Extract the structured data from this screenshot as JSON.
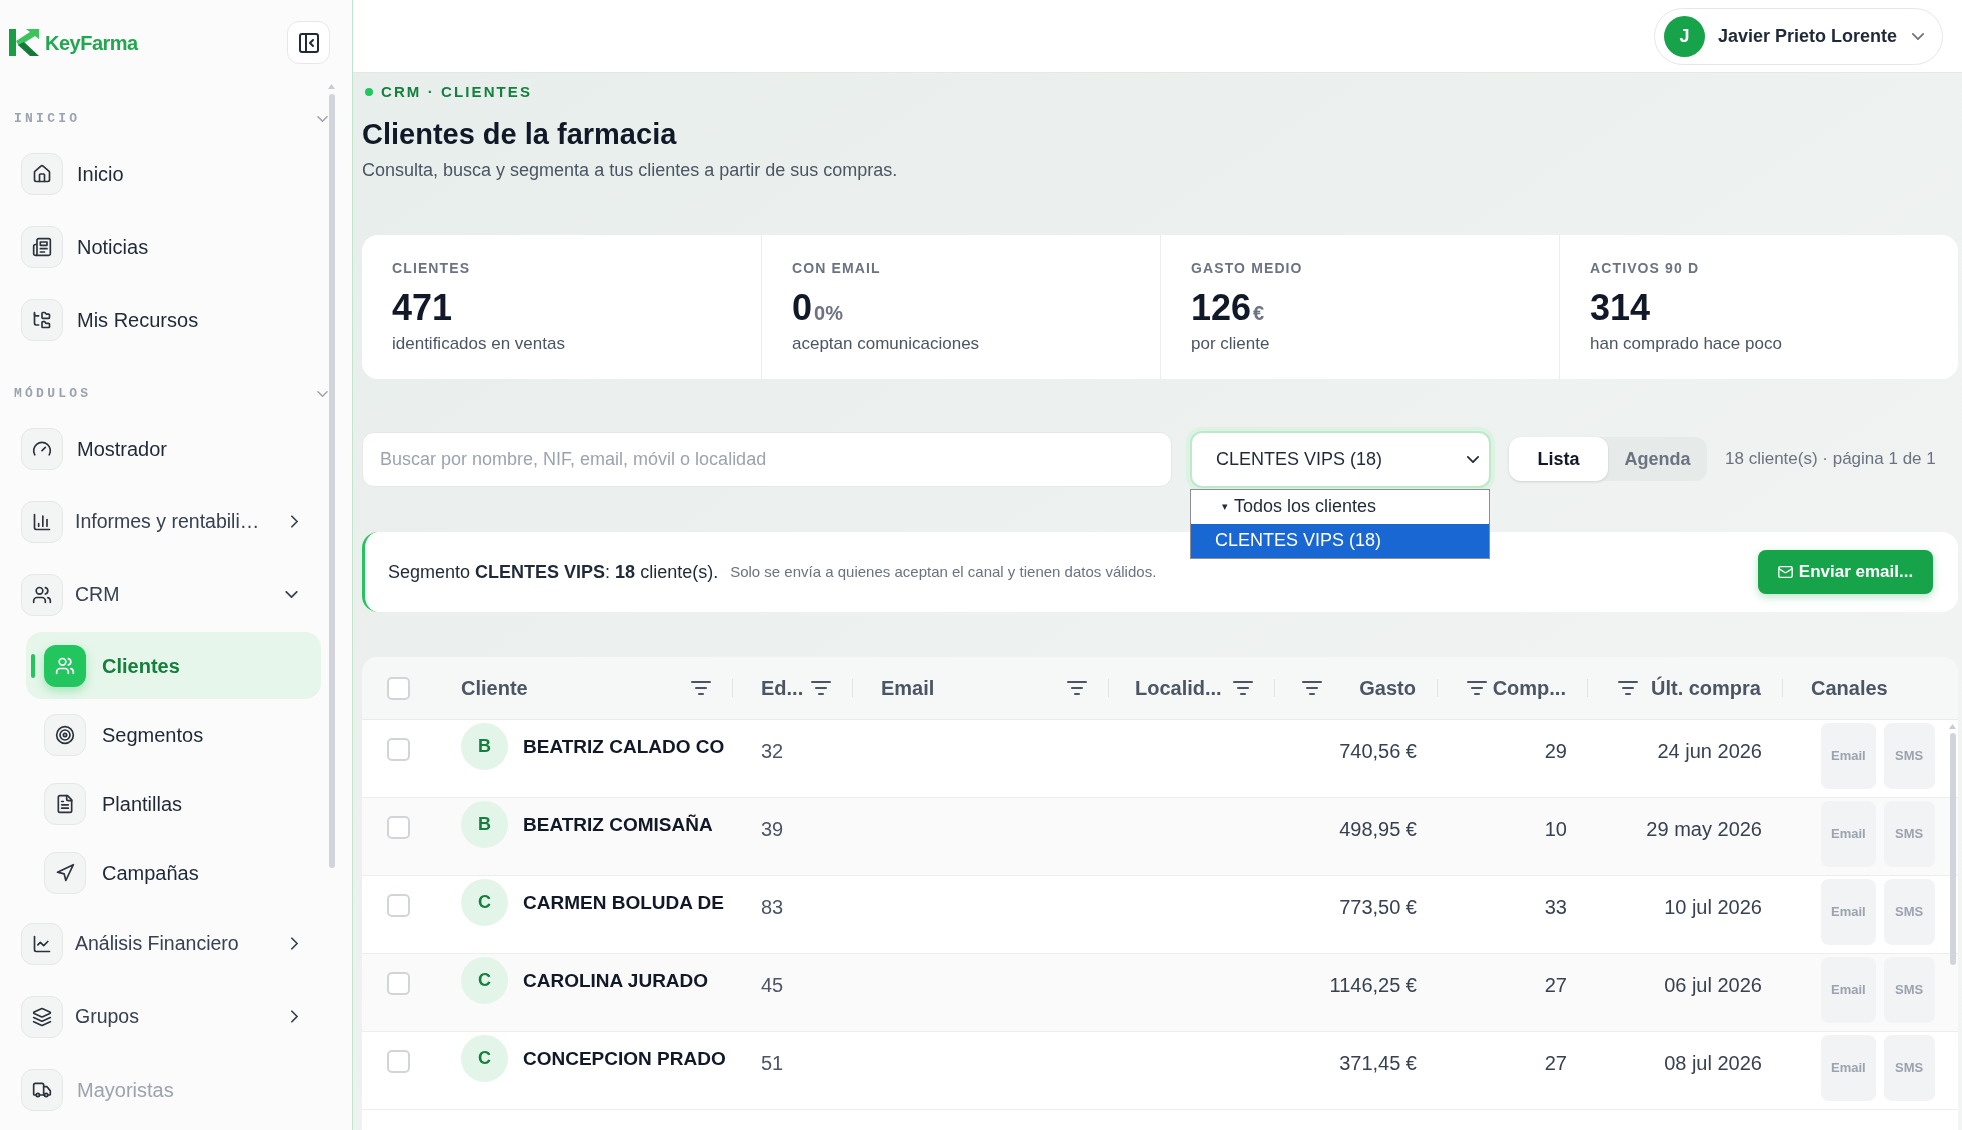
{
  "sidebar": {
    "brand": "KeyFarma",
    "sections": [
      {
        "title": "INICIO",
        "expanded": true,
        "items": [
          {
            "kind": "link",
            "label": "Inicio",
            "selected": false,
            "disabled": false
          },
          {
            "kind": "link",
            "label": "Noticias",
            "selected": false,
            "disabled": false
          },
          {
            "kind": "link",
            "label": "Mis Recursos",
            "selected": false,
            "disabled": false
          }
        ]
      },
      {
        "title": "MÓDULOS",
        "expanded": true,
        "items": [
          {
            "kind": "link",
            "label": "Mostrador",
            "selected": false,
            "disabled": false
          },
          {
            "kind": "group",
            "label": "Informes y rentabili…",
            "expanded": false
          },
          {
            "kind": "group",
            "label": "CRM",
            "expanded": true,
            "children": [
              {
                "label": "Clientes",
                "selected": true
              },
              {
                "label": "Segmentos",
                "selected": false
              },
              {
                "label": "Plantillas",
                "selected": false
              },
              {
                "label": "Campañas",
                "selected": false
              }
            ]
          },
          {
            "kind": "group",
            "label": "Análisis Financiero",
            "expanded": false
          },
          {
            "kind": "group",
            "label": "Grupos",
            "expanded": false
          },
          {
            "kind": "link",
            "label": "Mayoristas",
            "selected": false,
            "disabled": true
          }
        ]
      }
    ]
  },
  "header": {
    "user": {
      "initial": "J",
      "name": "Javier Prieto Lorente"
    }
  },
  "page": {
    "breadcrumb": "CRM · CLIENTES",
    "title": "Clientes de la farmacia",
    "subtitle": "Consulta, busca y segmenta a tus clientes a partir de sus compras."
  },
  "stats": [
    {
      "label": "CLIENTES",
      "value": "471",
      "note": "identificados en ventas"
    },
    {
      "label": "CON EMAIL",
      "value": "0",
      "unit": "0%",
      "note": "aceptan comunicaciones"
    },
    {
      "label": "GASTO MEDIO",
      "value": "126",
      "unit": "€",
      "note": "por cliente"
    },
    {
      "label": "ACTIVOS 90 D",
      "value": "314",
      "note": "han comprado hace poco"
    }
  ],
  "toolbar": {
    "search": {
      "placeholder": "Buscar por nombre, NIF, email, móvil o localidad"
    },
    "segment_select": {
      "value": "CLENTES VIPS (18)",
      "expanded": true,
      "options": [
        {
          "marker": "▾",
          "label": "Todos los clientes",
          "selected": false
        },
        {
          "label": "CLENTES VIPS (18)",
          "selected": true
        }
      ]
    },
    "view_tabs": [
      {
        "label": "Lista",
        "selected": true
      },
      {
        "label": "Agenda",
        "selected": false
      }
    ],
    "results": "18 cliente(s) · página 1 de 1"
  },
  "segment_banner": {
    "summary": "Segmento **CLENTES VIPS**: **18** cliente(s).",
    "note": "Solo se envía a quienes aceptan el canal y tienen datos válidos.",
    "button": "Enviar email..."
  },
  "table": {
    "select_all": {
      "checked": false
    },
    "columns": [
      {
        "label": "Cliente",
        "kind": "text",
        "filter": true
      },
      {
        "label": "Ed...",
        "kind": "text",
        "filter": true
      },
      {
        "label": "Email",
        "kind": "text",
        "filter": true
      },
      {
        "label": "Localid...",
        "kind": "text",
        "filter": true
      },
      {
        "label": "Gasto",
        "kind": "number",
        "filter": true
      },
      {
        "label": "Comp...",
        "kind": "number",
        "filter": true
      },
      {
        "label": "Últ. compra",
        "kind": "number",
        "filter": true
      },
      {
        "label": "Canales",
        "kind": "text",
        "filter": false
      }
    ],
    "rows": [
      {
        "checked": false,
        "initial": "B",
        "name": "BEATRIZ CALADO CO",
        "age": "32",
        "spend": "740,56 €",
        "purchases": "29",
        "last_purchase": "24 jun 2026",
        "channels": [
          {
            "label": "Email",
            "on": false
          },
          {
            "label": "SMS",
            "on": false
          }
        ]
      },
      {
        "checked": false,
        "initial": "B",
        "name": "BEATRIZ COMISAÑA",
        "age": "39",
        "spend": "498,95 €",
        "purchases": "10",
        "last_purchase": "29 may 2026",
        "channels": [
          {
            "label": "Email",
            "on": false
          },
          {
            "label": "SMS",
            "on": false
          }
        ]
      },
      {
        "checked": false,
        "initial": "C",
        "name": "CARMEN BOLUDA DE",
        "age": "83",
        "spend": "773,50 €",
        "purchases": "33",
        "last_purchase": "10 jul 2026",
        "channels": [
          {
            "label": "Email",
            "on": false
          },
          {
            "label": "SMS",
            "on": false
          }
        ]
      },
      {
        "checked": false,
        "initial": "C",
        "name": "CAROLINA JURADO",
        "age": "45",
        "spend": "1146,25 €",
        "purchases": "27",
        "last_purchase": "06 jul 2026",
        "channels": [
          {
            "label": "Email",
            "on": false
          },
          {
            "label": "SMS",
            "on": false
          }
        ]
      },
      {
        "checked": false,
        "initial": "C",
        "name": "CONCEPCION PRADO",
        "age": "51",
        "spend": "371,45 €",
        "purchases": "27",
        "last_purchase": "08 jul 2026",
        "channels": [
          {
            "label": "Email",
            "on": false
          },
          {
            "label": "SMS",
            "on": false
          }
        ]
      }
    ]
  }
}
